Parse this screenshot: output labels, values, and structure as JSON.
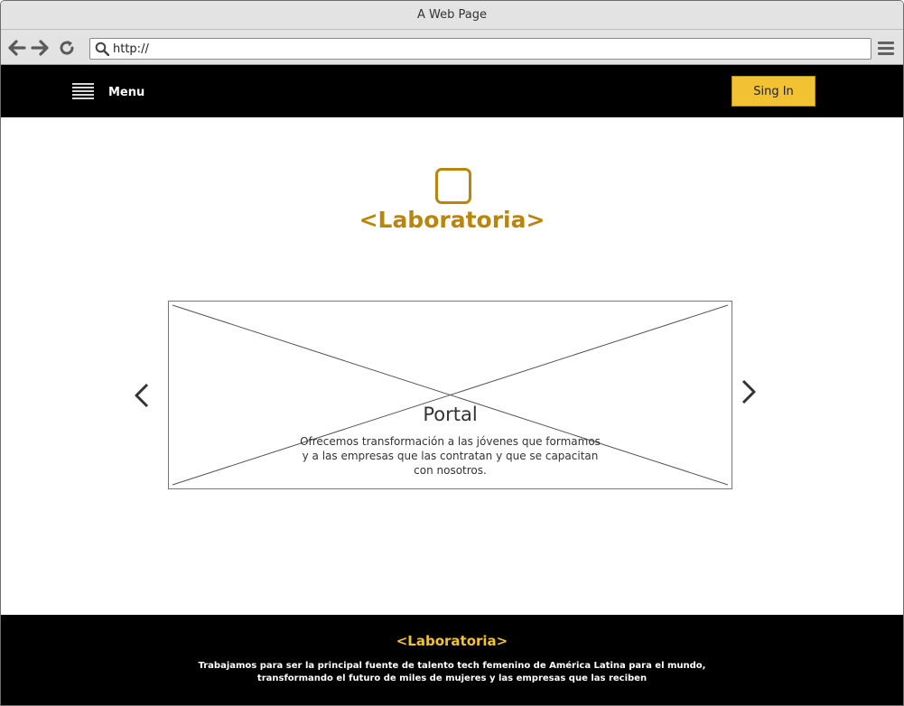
{
  "browser": {
    "title": "A Web Page",
    "url": "http://"
  },
  "nav": {
    "menu_label": "Menu",
    "signin_label": "Sing In"
  },
  "hero": {
    "brand": "<Laboratoria>"
  },
  "carousel": {
    "slide_title": "Portal",
    "slide_text_line1": "Ofrecemos transformación a las jóvenes que formamos",
    "slide_text_line2": "y a las empresas que las contratan y que se capacitan",
    "slide_text_line3": "con nosotros."
  },
  "footer": {
    "brand": "<Laboratoria>",
    "text_line1": "Trabajamos para ser la principal fuente de talento tech femenino de América Latina para el mundo,",
    "text_line2": "transformando el futuro de miles de mujeres y las empresas que las reciben"
  },
  "colors": {
    "accent": "#f2c232",
    "brand_gold": "#b8860b",
    "nav_bg": "#000000"
  }
}
